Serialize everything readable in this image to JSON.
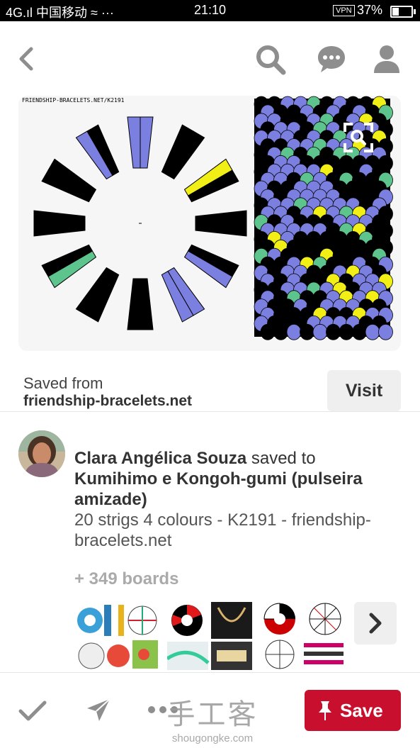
{
  "status_bar": {
    "carrier": "4G.ıl 中国移动 ≈ ···",
    "time": "21:10",
    "vpn": "VPN",
    "battery": "37%",
    "battery_level": 0.37
  },
  "nav": {
    "back_icon": "chevron-left-icon",
    "search_icon": "search-icon",
    "messages_icon": "chat-bubble-icon",
    "profile_icon": "person-icon"
  },
  "pin": {
    "image_url_text": "FRIENDSHIP-BRACELETS.NET/K2191",
    "colors": {
      "black": "#000000",
      "periwinkle": "#7b7fe0",
      "yellow": "#f2ef16",
      "green": "#5dc48d",
      "card_bg": "#f6f6f6"
    }
  },
  "source": {
    "label": "Saved from",
    "site": "friendship-bracelets.net",
    "visit_label": "Visit"
  },
  "saver": {
    "name": "Clara Angélica Souza",
    "saved_to_text": " saved to ",
    "board": "Kumihimo e Kongoh-gumi (pulseira amizade)",
    "description": "20 strigs 4 colours - K2191 - friendship-bracelets.net"
  },
  "boards": {
    "count_label": "+ 349 boards"
  },
  "actions": {
    "done_icon": "checkmark-icon",
    "send_icon": "send-icon",
    "more_icon": "more-icon",
    "save_label": "Save",
    "save_color": "#c8102e"
  },
  "watermark": {
    "cn": "手工客",
    "url": "shougongke.com"
  }
}
